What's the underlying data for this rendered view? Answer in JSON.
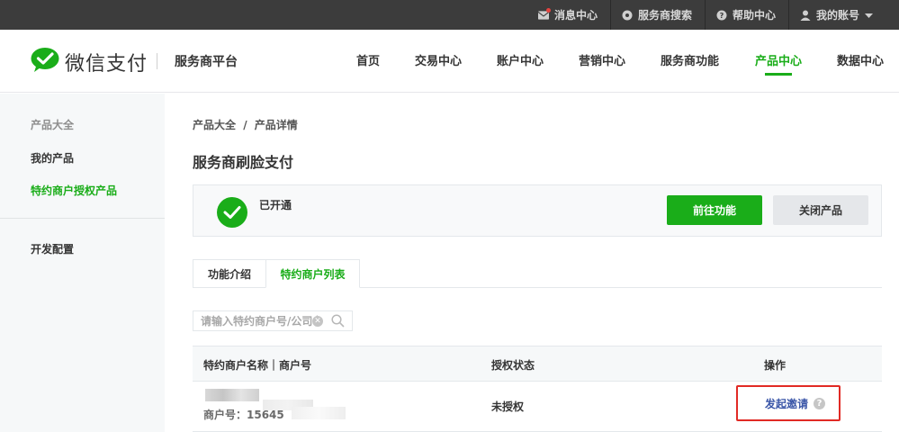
{
  "topbar": {
    "messages": "消息中心",
    "provider_search": "服务商搜索",
    "help": "帮助中心",
    "account": "我的账号"
  },
  "header": {
    "logo_text": "微信支付",
    "platform": "服务商平台",
    "nav": [
      "首页",
      "交易中心",
      "账户中心",
      "营销中心",
      "服务商功能",
      "产品中心",
      "数据中心"
    ],
    "active_nav": "产品中心"
  },
  "sidebar": {
    "group_title": "产品大全",
    "items": [
      "我的产品",
      "特约商户授权产品"
    ],
    "active_item": "特约商户授权产品",
    "dev_config": "开发配置"
  },
  "breadcrumb": {
    "root": "产品大全",
    "separator": "/",
    "current": "产品详情"
  },
  "page_title": "服务商刷脸支付",
  "status": {
    "text": "已开通",
    "primary_button": "前往功能",
    "secondary_button": "关闭产品"
  },
  "tabs": [
    {
      "label": "功能介绍",
      "active": false
    },
    {
      "label": "特约商户列表",
      "active": true
    }
  ],
  "search": {
    "placeholder": "请输入特约商户号/公司名称"
  },
  "table": {
    "columns": [
      "特约商户名称｜商户号",
      "授权状态",
      "操作"
    ],
    "rows": [
      {
        "merchant_id_prefix": "商户号：15645",
        "status": "未授权",
        "action": "发起邀请"
      }
    ]
  },
  "colors": {
    "brand_green": "#1aad19",
    "topbar_bg": "#3c3c3c",
    "highlight_red": "#e12a25",
    "link_blue": "#3a56a8"
  }
}
